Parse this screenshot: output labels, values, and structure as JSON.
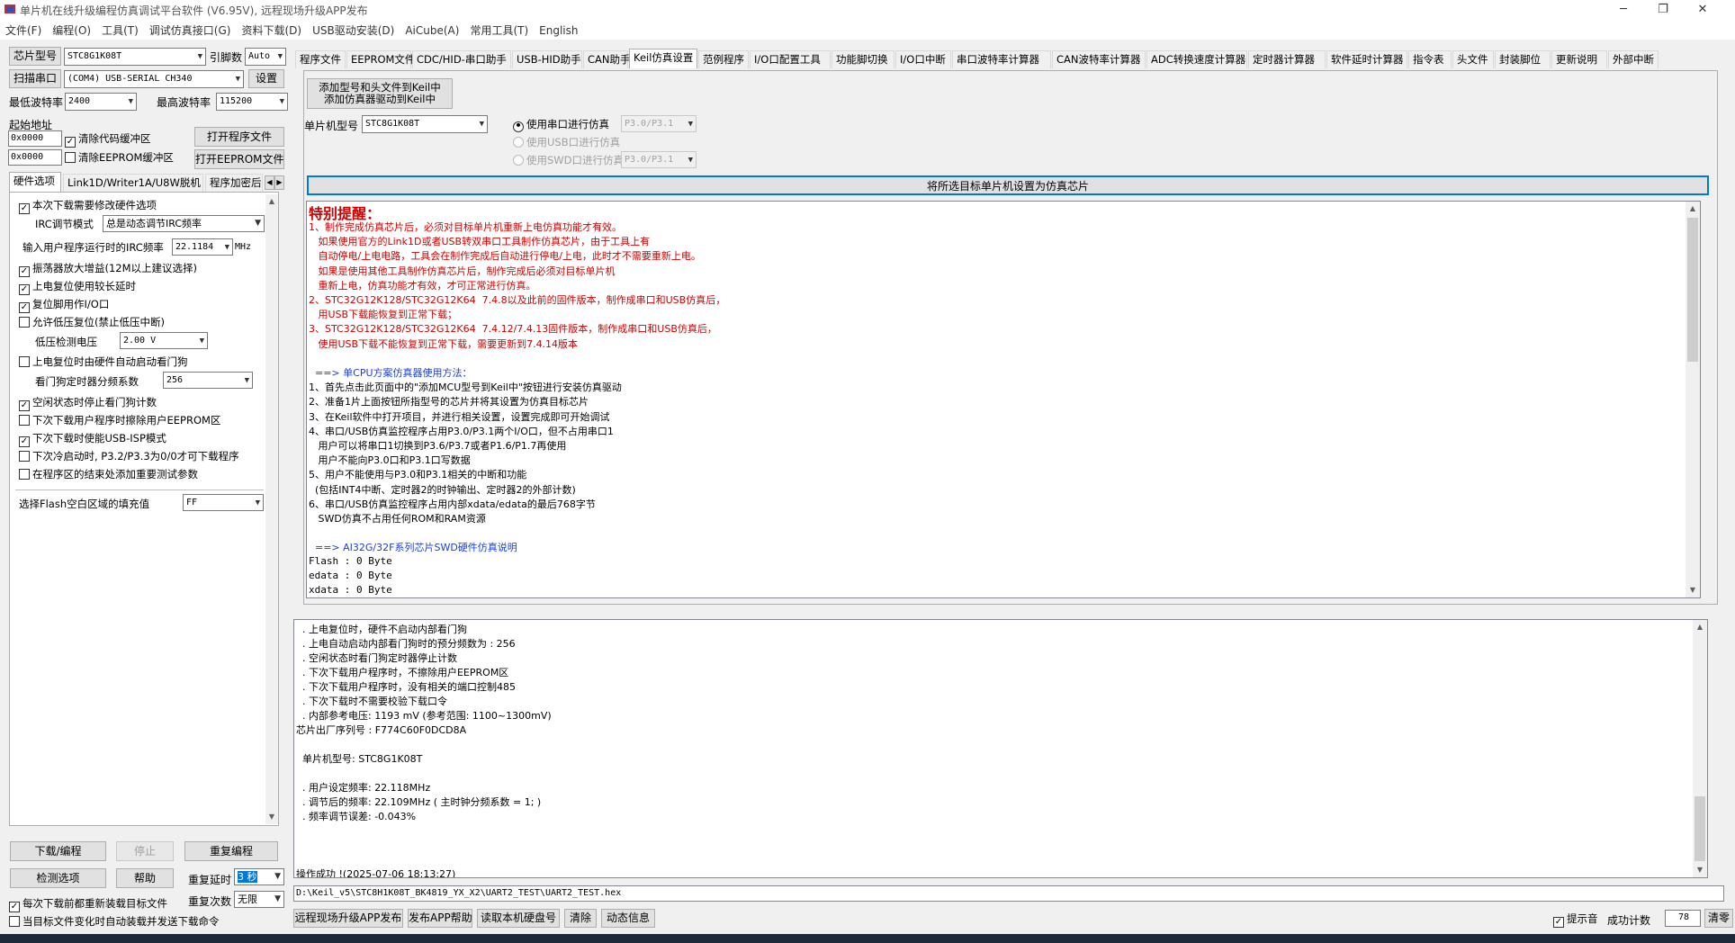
{
  "window": {
    "title": "单片机在线升级编程仿真调试平台软件 (V6.95V), 远程现场升级APP发布",
    "minimize": "─",
    "maximize": "❐",
    "close": "✕"
  },
  "menu": [
    "文件(F)",
    "编程(O)",
    "工具(T)",
    "调试仿真接口(G)",
    "资料下载(D)",
    "USB驱动安装(D)",
    "AiCube(A)",
    "常用工具(T)",
    "English"
  ],
  "left": {
    "chip_btn": "芯片型号",
    "chip_value": "STC8G1K08T",
    "pins_label": "引脚数",
    "pins_value": "Auto",
    "scan_btn": "扫描串口",
    "port_value": "(COM4) USB-SERIAL CH340",
    "settings_btn": "设置",
    "min_baud_label": "最低波特率",
    "min_baud_value": "2400",
    "max_baud_label": "最高波特率",
    "max_baud_value": "115200",
    "start_addr_label": "起始地址",
    "addr1": "0x0000",
    "addr2": "0x0000",
    "clear_code": "清除代码缓冲区",
    "clear_eeprom": "清除EEPROM缓冲区",
    "open_prog_btn": "打开程序文件",
    "open_eeprom_btn": "打开EEPROM文件",
    "tabs": [
      "硬件选项",
      "Link1D/Writer1A/U8W脱机",
      "程序加密后"
    ],
    "hw": {
      "opt1": "本次下载需要修改硬件选项",
      "irc_mode_label": "IRC调节模式",
      "irc_mode_value": "总是动态调节IRC频率",
      "irc_freq_label": "输入用户程序运行时的IRC频率",
      "irc_freq_value": "22.1184",
      "irc_unit": "MHz",
      "opt2": "振荡器放大增益(12M以上建议选择)",
      "opt3": "上电复位使用较长延时",
      "opt4": "复位脚用作I/O口",
      "opt5": "允许低压复位(禁止低压中断)",
      "lv_label": "低压检测电压",
      "lv_value": "2.00 V",
      "opt6": "上电复位时由硬件自动启动看门狗",
      "wdt_label": "看门狗定时器分频系数",
      "wdt_value": "256",
      "opt7": "空闲状态时停止看门狗计数",
      "opt8": "下次下载用户程序时擦除用户EEPROM区",
      "opt9": "下次下载时使能USB-ISP模式",
      "opt10": "下次冷启动时, P3.2/P3.3为0/0才可下载程序",
      "opt11": "在程序区的结束处添加重要测试参数",
      "fill_label": "选择Flash空白区域的填充值",
      "fill_value": "FF"
    },
    "download_btn": "下载/编程",
    "stop_btn": "停止",
    "reprog_btn": "重复编程",
    "check_btn": "检测选项",
    "help_btn": "帮助",
    "repeat_delay_label": "重复延时",
    "repeat_delay_value": "3 秒",
    "repeat_count_label": "重复次数",
    "repeat_count_value": "无限",
    "reload_each": "每次下载前都重新装载目标文件",
    "auto_reload": "当目标文件变化时自动装载并发送下载命令"
  },
  "top_tabs": [
    "程序文件",
    "EEPROM文件",
    "CDC/HID-串口助手",
    "USB-HID助手",
    "CAN助手",
    "Keil仿真设置",
    "范例程序",
    "I/O口配置工具",
    "功能脚切换",
    "I/O口中断",
    "串口波特率计算器",
    "CAN波特率计算器",
    "ADC转换速度计算器",
    "定时器计算器",
    "软件延时计算器",
    "指令表",
    "头文件",
    "封装脚位",
    "更新说明",
    "外部中断"
  ],
  "keil": {
    "add_btn_line1": "添加型号和头文件到Keil中",
    "add_btn_line2": "添加仿真器驱动到Keil中",
    "mcu_label": "单片机型号",
    "mcu_value": "STC8G1K08T",
    "radio_serial": "使用串口进行仿真",
    "radio_serial_port": "P3.0/P3.1",
    "radio_usb": "使用USB口进行仿真",
    "radio_swd": "使用SWD口进行仿真",
    "radio_swd_port": "P3.0/P3.1",
    "set_chip_btn": "将所选目标单片机设置为仿真芯片",
    "notes_title": "特别提醒：",
    "notes": [
      {
        "c": "red",
        "t": "1、制作完成仿真芯片后，必须对目标单片机重新上电仿真功能才有效。"
      },
      {
        "c": "red",
        "t": "   如果使用官方的Link1D或者USB转双串口工具制作仿真芯片，由于工具上有"
      },
      {
        "c": "red",
        "t": "   自动停电/上电电路，工具会在制作完成后自动进行停电/上电，此时才不需要重新上电。"
      },
      {
        "c": "red",
        "t": "   如果是使用其他工具制作仿真芯片后，制作完成后必须对目标单片机"
      },
      {
        "c": "red",
        "t": "   重新上电，仿真功能才有效，才可正常进行仿真。"
      },
      {
        "c": "red",
        "t": "2、STC32G12K128/STC32G12K64  7.4.8以及此前的固件版本，制作成串口和USB仿真后，"
      },
      {
        "c": "red",
        "t": "   用USB下载能恢复到正常下载；"
      },
      {
        "c": "red",
        "t": "3、STC32G12K128/STC32G12K64  7.4.12/7.4.13固件版本，制作成串口和USB仿真后，"
      },
      {
        "c": "red",
        "t": "   使用USB下载不能恢复到正常下载，需要更新到7.4.14版本"
      },
      {
        "c": "blk",
        "t": ""
      },
      {
        "c": "blue",
        "t": "  ==> 单CPU方案仿真器使用方法："
      },
      {
        "c": "blk",
        "t": "1、首先点击此页面中的\"添加MCU型号到Keil中\"按钮进行安装仿真驱动"
      },
      {
        "c": "blk",
        "t": "2、准备1片上面按钮所指型号的芯片并将其设置为仿真目标芯片"
      },
      {
        "c": "blk",
        "t": "3、在Keil软件中打开项目，并进行相关设置，设置完成即可开始调试"
      },
      {
        "c": "blk",
        "t": "4、串口/USB仿真监控程序占用P3.0/P3.1两个I/O口，但不占用串口1"
      },
      {
        "c": "blk",
        "t": "   用户可以将串口1切换到P3.6/P3.7或者P1.6/P1.7再使用"
      },
      {
        "c": "blk",
        "t": "   用户不能向P3.0口和P3.1口写数据"
      },
      {
        "c": "blk",
        "t": "5、用户不能使用与P3.0和P3.1相关的中断和功能"
      },
      {
        "c": "blk",
        "t": "  (包括INT4中断、定时器2的时钟输出、定时器2的外部计数)"
      },
      {
        "c": "blk",
        "t": "6、串口/USB仿真监控程序占用内部xdata/edata的最后768字节"
      },
      {
        "c": "blk",
        "t": "   SWD仿真不占用任何ROM和RAM资源"
      },
      {
        "c": "blk",
        "t": ""
      },
      {
        "c": "blue",
        "t": "  ==> AI32G/32F系列芯片SWD硬件仿真说明"
      },
      {
        "c": "mono",
        "t": "Flash : 0 Byte"
      },
      {
        "c": "mono",
        "t": "edata : 0 Byte"
      },
      {
        "c": "mono",
        "t": "xdata : 0 Byte"
      }
    ]
  },
  "log": [
    "  . 上电复位时，硬件不启动内部看门狗",
    "  . 上电自动启动内部看门狗时的预分频数为 : 256",
    "  . 空闲状态时看门狗定时器停止计数",
    "  . 下次下载用户程序时，不擦除用户EEPROM区",
    "  . 下次下载用户程序时，没有相关的端口控制485",
    "  . 下次下载时不需要校验下载口令",
    "  . 内部参考电压: 1193 mV (参考范围: 1100~1300mV)",
    "芯片出厂序列号 : F774C60F0DCD8A",
    "",
    "  单片机型号: STC8G1K08T",
    "",
    "  . 用户设定频率: 22.118MHz",
    "  . 调节后的频率: 22.109MHz ( 主时钟分频系数 = 1; )",
    "  . 频率调节误差: -0.043%",
    "",
    "",
    "",
    "操作成功 !(2025-07-06 18:13:27)"
  ],
  "path": "D:\\Keil_v5\\STC8H1K08T_BK4819_YX_X2\\UART2_TEST\\UART2_TEST.hex",
  "bottom": {
    "remote_btn": "远程现场升级APP发布",
    "publish_help_btn": "发布APP帮助",
    "read_disk_btn": "读取本机硬盘号",
    "clear_btn": "清除",
    "dynamic_btn": "动态信息",
    "beep_label": "提示音",
    "success_label": "成功计数",
    "success_value": "78",
    "zero_btn": "清零"
  }
}
